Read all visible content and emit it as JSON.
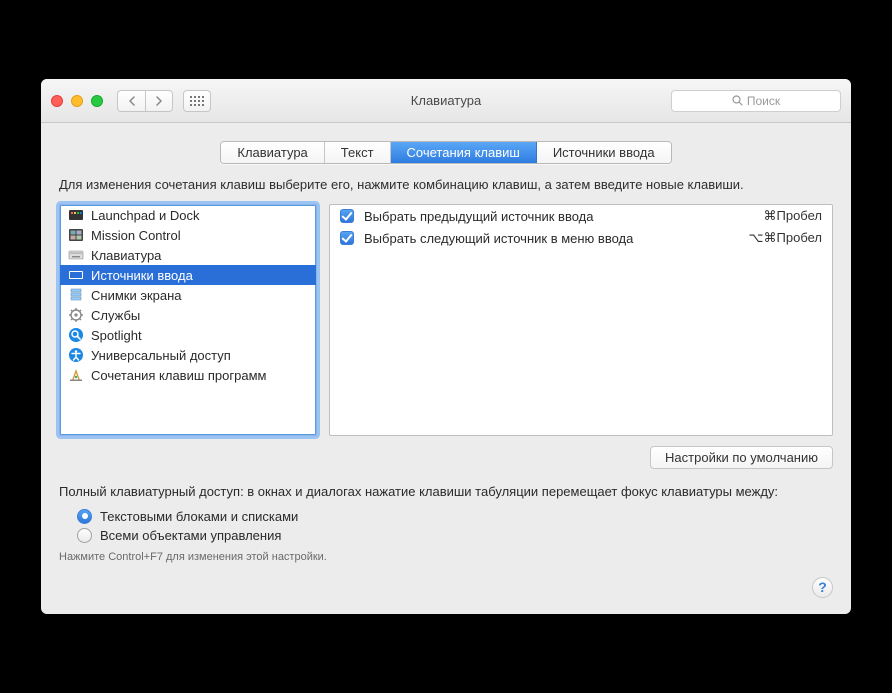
{
  "window": {
    "title": "Клавиатура",
    "search_placeholder": "Поиск"
  },
  "tabs": [
    {
      "label": "Клавиатура",
      "active": false
    },
    {
      "label": "Текст",
      "active": false
    },
    {
      "label": "Сочетания клавиш",
      "active": true
    },
    {
      "label": "Источники ввода",
      "active": false
    }
  ],
  "instructions": "Для изменения сочетания клавиш выберите его, нажмите комбинацию клавиш, а затем введите новые клавиши.",
  "categories": [
    {
      "name": "Launchpad и Dock",
      "icon": "launchpad-icon",
      "selected": false
    },
    {
      "name": "Mission Control",
      "icon": "mission-control-icon",
      "selected": false
    },
    {
      "name": "Клавиатура",
      "icon": "keyboard-icon",
      "selected": false
    },
    {
      "name": "Источники ввода",
      "icon": "input-sources-icon",
      "selected": true
    },
    {
      "name": "Снимки экрана",
      "icon": "screenshots-icon",
      "selected": false
    },
    {
      "name": "Службы",
      "icon": "services-icon",
      "selected": false
    },
    {
      "name": "Spotlight",
      "icon": "spotlight-icon",
      "selected": false
    },
    {
      "name": "Универсальный доступ",
      "icon": "accessibility-icon",
      "selected": false
    },
    {
      "name": "Сочетания клавиш программ",
      "icon": "app-shortcuts-icon",
      "selected": false
    }
  ],
  "shortcuts": [
    {
      "checked": true,
      "label": "Выбрать предыдущий источник ввода",
      "keys": "⌘Пробел"
    },
    {
      "checked": true,
      "label": "Выбрать следующий источник в меню ввода",
      "keys": "⌥⌘Пробел"
    }
  ],
  "defaults_button": "Настройки по умолчанию",
  "fka": {
    "text": "Полный клавиатурный доступ: в окнах и диалогах нажатие клавиши табуляции перемещает фокус клавиатуры между:",
    "options": [
      {
        "label": "Текстовыми блоками и списками",
        "checked": true
      },
      {
        "label": "Всеми объектами управления",
        "checked": false
      }
    ],
    "hint": "Нажмите Control+F7 для изменения этой настройки."
  },
  "help_glyph": "?"
}
